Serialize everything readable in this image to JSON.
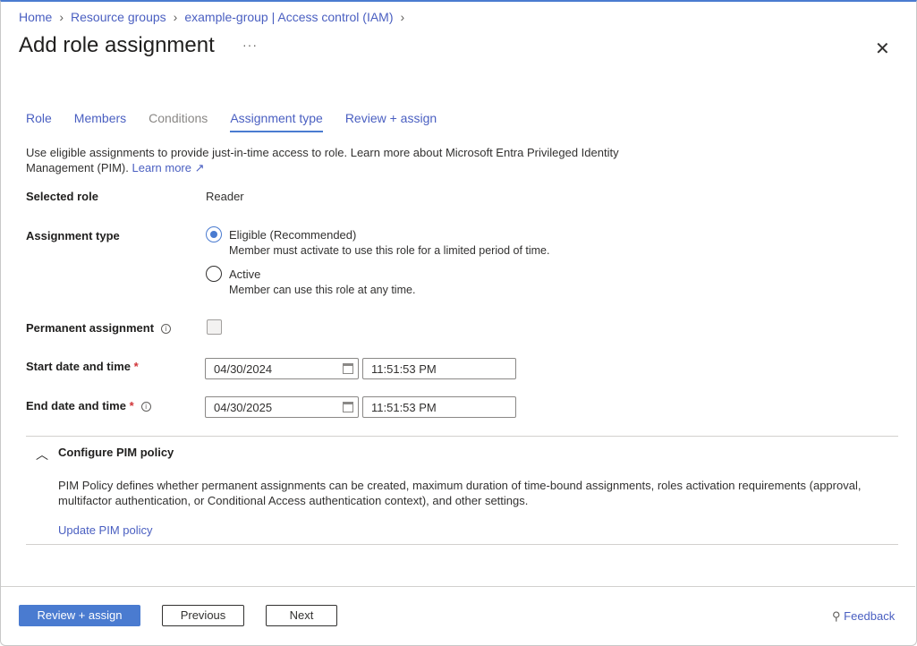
{
  "breadcrumb": [
    "Home",
    "Resource groups",
    "example-group | Access control (IAM)"
  ],
  "title": "Add role assignment",
  "more": "···",
  "close": "✕",
  "tabs": [
    {
      "label": "Role"
    },
    {
      "label": "Members"
    },
    {
      "label": "Conditions"
    },
    {
      "label": "Assignment type"
    },
    {
      "label": "Review + assign"
    }
  ],
  "description": {
    "text": "Use eligible assignments to provide just-in-time access to role. Learn more about Microsoft Entra Privileged Identity Management (PIM).",
    "link": "Learn more"
  },
  "form": {
    "selected_role_label": "Selected role",
    "selected_role": "Reader",
    "assignment_type_label": "Assignment type",
    "options": [
      {
        "label": "Eligible (Recommended)",
        "desc": "Member must activate to use this role for a limited period of time."
      },
      {
        "label": "Active",
        "desc": "Member can use this role at any time."
      }
    ],
    "permanent_label": "Permanent assignment",
    "start_label": "Start date and time",
    "start_date": "04/30/2024",
    "start_time": "11:51:53 PM",
    "end_label": "End date and time",
    "end_date": "04/30/2025",
    "end_time": "11:51:53 PM",
    "required": "*"
  },
  "pim": {
    "title": "Configure PIM policy",
    "text": "PIM Policy defines whether permanent assignments can be created, maximum duration of time-bound assignments, roles activation requirements (approval, multifactor authentication, or Conditional Access authentication context), and other settings.",
    "link": "Update PIM policy"
  },
  "footer": {
    "review": "Review + assign",
    "previous": "Previous",
    "next": "Next",
    "feedback": "Feedback"
  }
}
